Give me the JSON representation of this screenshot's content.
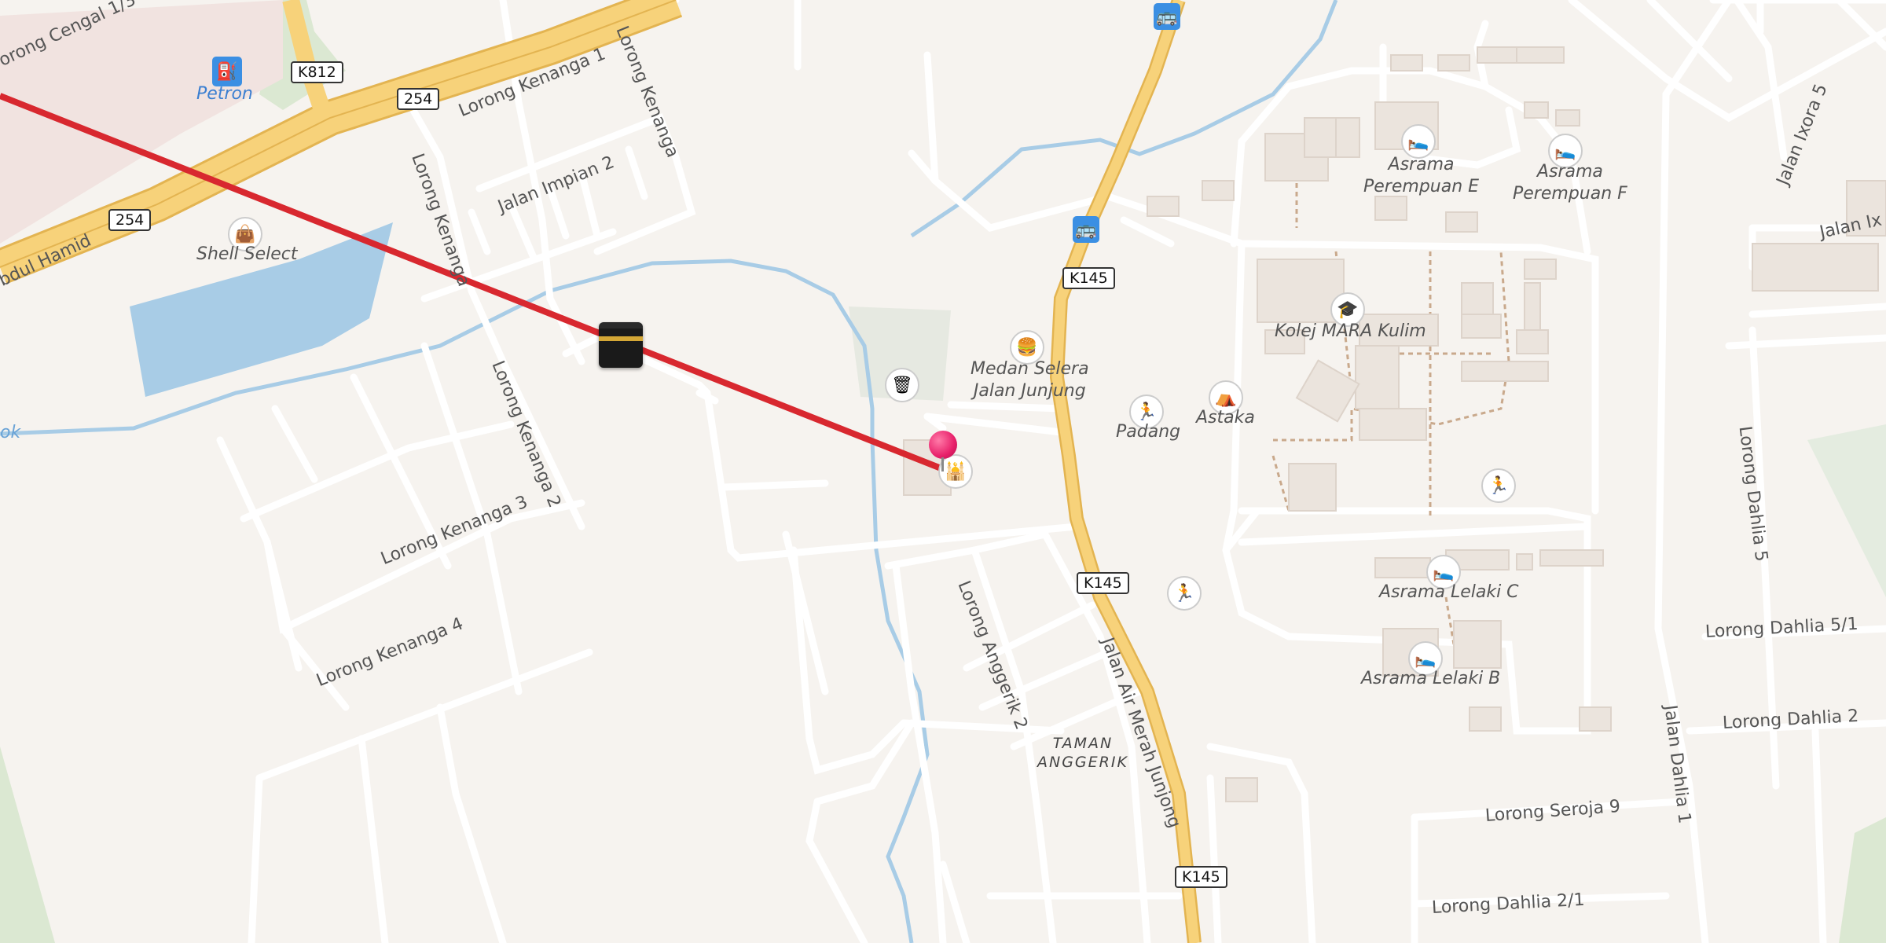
{
  "map": {
    "streets": [
      {
        "name": "street-label",
        "text": "orong Cengal 1/3"
      },
      {
        "name": "street-label",
        "text": "Lorong Kenanga 1"
      },
      {
        "name": "street-label",
        "text": "Lorong Kenanga"
      },
      {
        "name": "street-label",
        "text": "Jalan Impian 2"
      },
      {
        "name": "street-label",
        "text": "Lorong Kenanga"
      },
      {
        "name": "street-label",
        "text": "Lorong Kenanga 2"
      },
      {
        "name": "street-label",
        "text": "Lorong Kenanga 3"
      },
      {
        "name": "street-label",
        "text": "Lorong Kenanga 4"
      },
      {
        "name": "street-label",
        "text": "bdul Hamid"
      },
      {
        "name": "street-label",
        "text": "Lorong Anggerik 2"
      },
      {
        "name": "street-label",
        "text": "Jalan Air Merah Junjong"
      },
      {
        "name": "street-label",
        "text": "Jalan Ixora 5"
      },
      {
        "name": "street-label",
        "text": "Jalan Ix"
      },
      {
        "name": "street-label",
        "text": "Lorong Dahlia 5"
      },
      {
        "name": "street-label",
        "text": "Lorong Dahlia 5/1"
      },
      {
        "name": "street-label",
        "text": "Lorong Dahlia 2"
      },
      {
        "name": "street-label",
        "text": "Jalan Dahlia 1"
      },
      {
        "name": "street-label",
        "text": "Lorong Seroja 9"
      },
      {
        "name": "street-label",
        "text": "Lorong Dahlia 2/1"
      },
      {
        "name": "street-label",
        "text": "ok"
      }
    ],
    "shields": [
      "K812",
      "254",
      "254",
      "K145",
      "K145",
      "K145"
    ],
    "pois": [
      {
        "text": "Petron",
        "icon": "fuel-icon"
      },
      {
        "text": "Shell Select",
        "icon": "shop-icon"
      },
      {
        "text": "Medan Selera\nJalan Junjung",
        "icon": "food-icon"
      },
      {
        "text": "Padang",
        "icon": "sport-icon"
      },
      {
        "text": "Astaka",
        "icon": "pavilion-icon"
      },
      {
        "text": "Asrama\nPerempuan E",
        "icon": "bed-icon"
      },
      {
        "text": "Asrama\nPerempuan F",
        "icon": "bed-icon"
      },
      {
        "text": "Kolej MARA Kulim",
        "icon": "college-icon"
      },
      {
        "text": "Asrama Lelaki C",
        "icon": "bed-icon"
      },
      {
        "text": "Asrama Lelaki B",
        "icon": "bed-icon"
      }
    ],
    "area_label": "TAMAN\nANGGERIK",
    "colors": {
      "qibla_line": "#d8282f",
      "pin": "#e8206a",
      "water": "#a8cce6",
      "major_road": "#f7d27a",
      "park": "#cfe6cc"
    }
  }
}
